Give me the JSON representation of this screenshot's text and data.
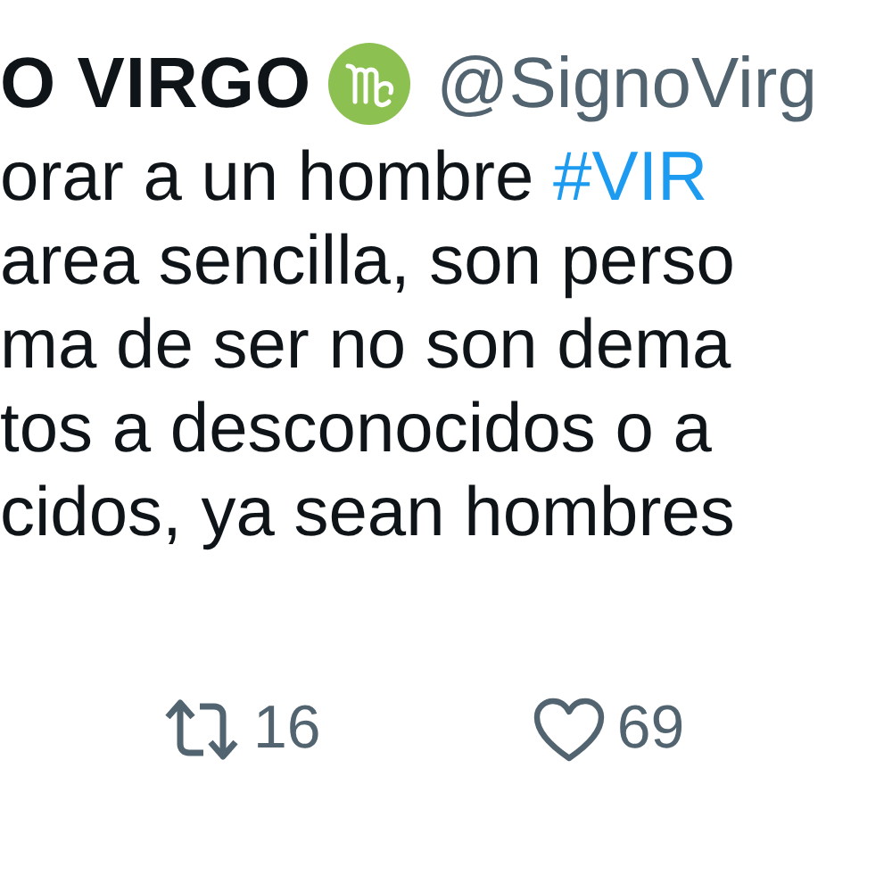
{
  "author": {
    "name": "O VIRGO",
    "handle": "@SignoVirg"
  },
  "body_lines": [
    {
      "text": "orar a un hombre ",
      "hashtag": "#VIR"
    },
    {
      "text": "area sencilla, son perso"
    },
    {
      "text": "ma de ser no son dema"
    },
    {
      "text": "tos a desconocidos o a"
    },
    {
      "text": "cidos, ya sean hombres"
    }
  ],
  "actions": [
    {
      "kind": "retweet",
      "count": "16"
    },
    {
      "kind": "like",
      "count": "69"
    }
  ]
}
